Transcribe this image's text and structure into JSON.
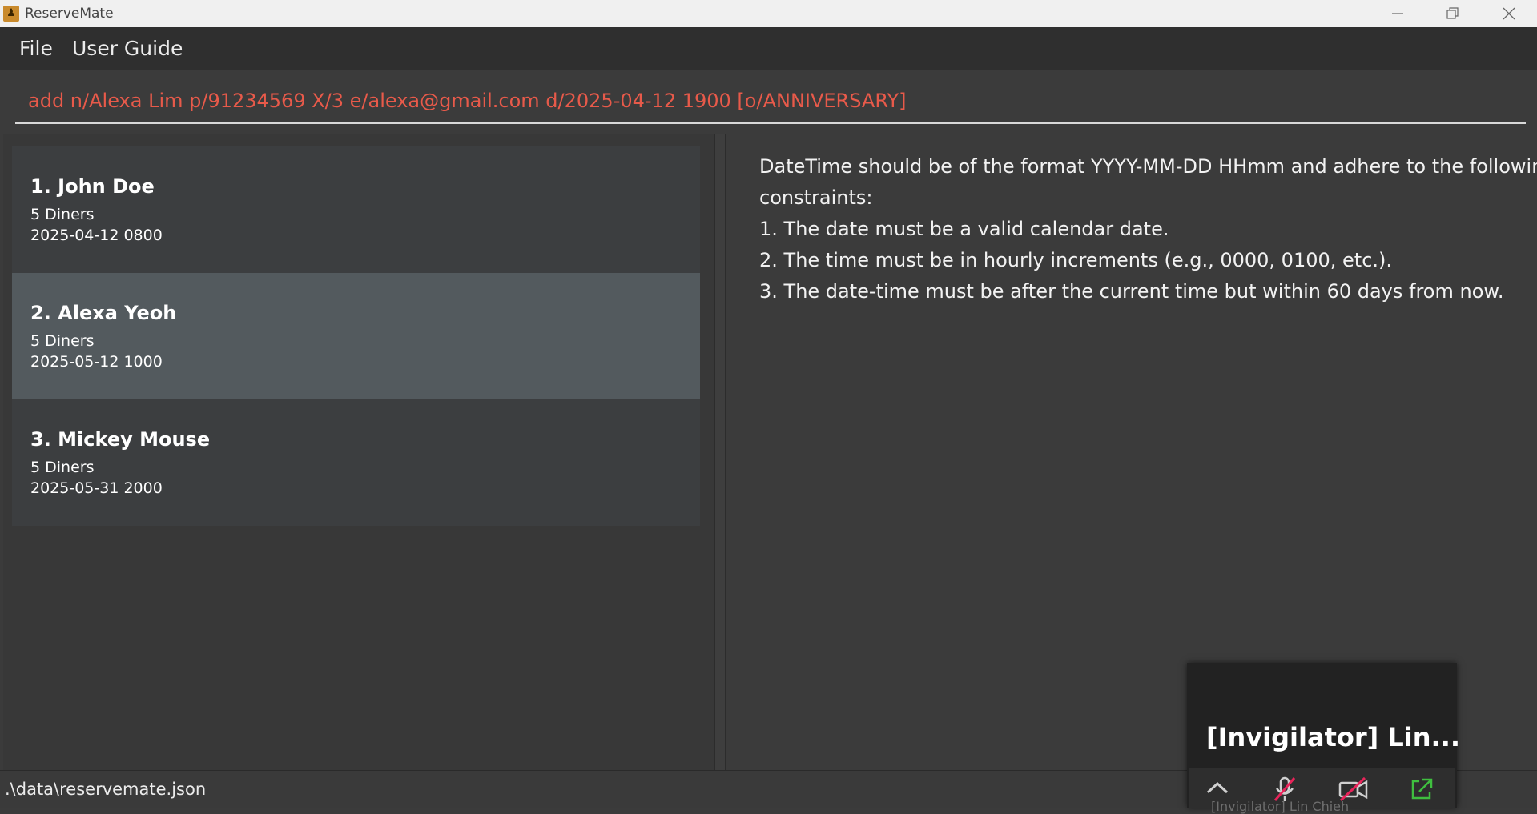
{
  "window": {
    "title": "ReserveMate",
    "app_icon_glyph": "♟"
  },
  "menu": {
    "items": [
      "File",
      "User Guide"
    ]
  },
  "command": {
    "text": "add n/Alexa Lim p/91234569 X/3 e/alexa@gmail.com d/2025-04-12 1900 [o/ANNIVERSARY]",
    "error_color": "#e85a4a"
  },
  "reservations": [
    {
      "name": "1. John Doe",
      "diners": "5 Diners",
      "datetime": "2025-04-12 0800"
    },
    {
      "name": "2. Alexa Yeoh",
      "diners": "5 Diners",
      "datetime": "2025-05-12 1000"
    },
    {
      "name": "3. Mickey Mouse",
      "diners": "5 Diners",
      "datetime": "2025-05-31 2000"
    }
  ],
  "selected_reservation": 2,
  "result": {
    "lines": [
      "DateTime should be of the format YYYY-MM-DD HHmm and adhere to the following",
      "constraints:",
      "1. The date must be a valid calendar date.",
      "2. The time must be in hourly increments (e.g., 0000, 0100, etc.).",
      "3. The date-time must be after the current time but within 60 days from now."
    ]
  },
  "status": {
    "file_path": ".\\data\\reservemate.json"
  },
  "video_overlay": {
    "label": "[Invigilator]  Lin...",
    "subtitle": "[Invigilator] Lin Chieh",
    "icons": [
      "chevron-up-icon",
      "microphone-muted-icon",
      "camera-off-icon",
      "share-icon"
    ],
    "muted_color": "#e8245a",
    "share_color": "#3fbf3f"
  },
  "colors": {
    "background": "#3b3b3b",
    "menubar": "#2f2f2f",
    "card": "#3c3e40",
    "card_selected": "#535a5e"
  }
}
